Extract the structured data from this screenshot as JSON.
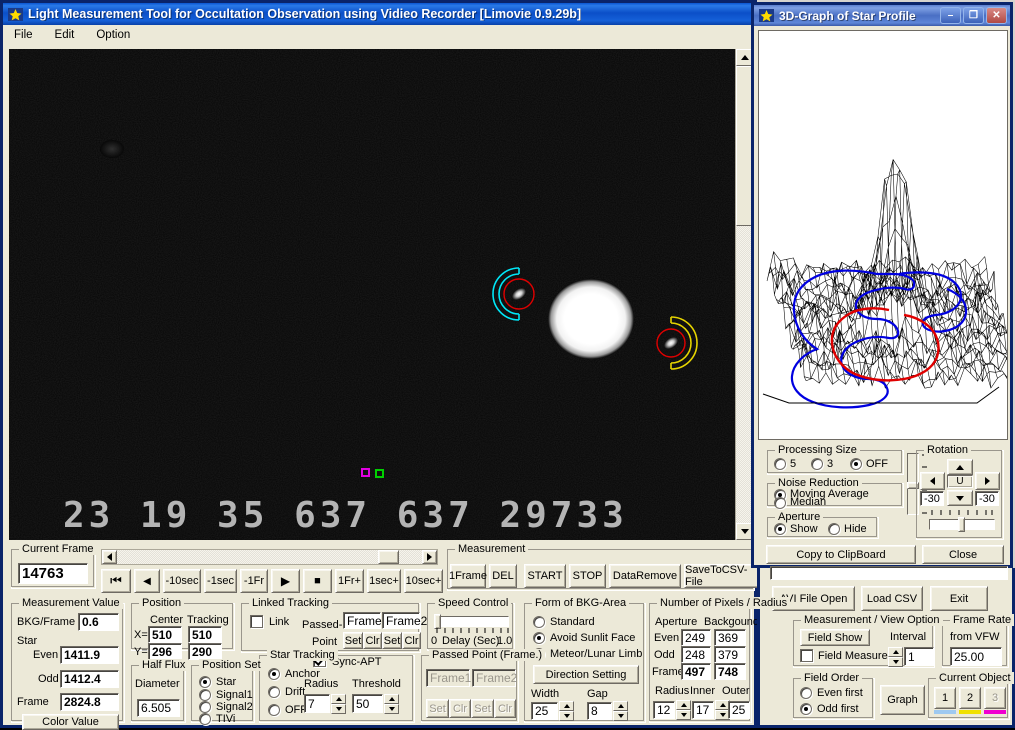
{
  "main_window": {
    "title": "Light Measurement Tool for Occultation Observation using Vidieo Recorder [Limovie 0.9.29b]",
    "menu": [
      "File",
      "Edit",
      "Option"
    ]
  },
  "video_overlay": {
    "vti_line": "23  19  35    637     637    29733"
  },
  "playback": {
    "current_frame_label": "Current Frame",
    "current_frame_value": "14763",
    "buttons": [
      "⏮",
      "◀",
      "-10sec",
      "-1sec",
      "-1Fr",
      "▶",
      "■",
      "1Fr+",
      "1sec+",
      "10sec+"
    ]
  },
  "measurement_toolbar": {
    "legend": "Measurement",
    "buttons": [
      "1Frame",
      "DEL",
      "START",
      "STOP",
      "DataRemove",
      "SaveToCSV-File"
    ]
  },
  "measurement_value": {
    "legend": "Measurement Value",
    "bkg_label": "BKG/Frame",
    "bkg_value": "0.6",
    "star_label": "Star",
    "even_label": "Even",
    "even_value": "1411.9",
    "odd_label": "Odd",
    "odd_value": "1412.4",
    "frame_label": "Frame",
    "frame_value": "2824.8",
    "color_value_button": "Color Value"
  },
  "position": {
    "legend": "Position",
    "center_header": "Center",
    "tracking_header": "Tracking",
    "x_label": "X=",
    "y_label": "Y=",
    "x_center": "510",
    "x_tracking": "510",
    "y_center": "296",
    "y_tracking": "290"
  },
  "half_flux": {
    "legend": "Half Flux",
    "sub_label": "Diameter",
    "value": "6.505"
  },
  "position_set": {
    "legend": "Position Set",
    "options": [
      "Star",
      "Signal1",
      "Signal2",
      "TIVi"
    ],
    "selected": "Star"
  },
  "linked_tracking": {
    "legend": "Linked Tracking",
    "link_label": "Link",
    "link_checked": false,
    "passed_label": "Passed-",
    "point_label": "Point",
    "frame1": "Frame1",
    "frame2": "Frame2",
    "set": "Set",
    "clr": "Clr"
  },
  "star_tracking": {
    "legend": "Star Tracking",
    "options": [
      "Anchor",
      "Drift",
      "OFF"
    ],
    "selected": "Anchor",
    "sync_apt_label": "Sync-APT",
    "sync_apt_checked": true,
    "radius_label": "Radius",
    "radius_value": "7",
    "threshold_label": "Threshold",
    "threshold_value": "50"
  },
  "speed_control": {
    "legend": "Speed Control",
    "min_label": "0",
    "name_label": "Delay (Sec)",
    "max_label": "1.0"
  },
  "passed_point": {
    "legend": "Passed Point (Frame.)",
    "frame1": "Frame1",
    "frame2": "Frame2",
    "set": "Set",
    "clr": "Clr"
  },
  "bkg_area": {
    "legend": "Form of BKG-Area",
    "options": [
      "Standard",
      "Avoid Sunlit Face",
      "Meteor/Lunar Limb"
    ],
    "selected": "Avoid Sunlit Face",
    "direction_button": "Direction Setting",
    "width_label": "Width",
    "width_value": "25",
    "gap_label": "Gap",
    "gap_value": "8"
  },
  "pixels_radius": {
    "legend": "Number of Pixels / Radius",
    "aperture_header": "Aperture",
    "background_header": "Backgound",
    "rows": [
      {
        "label": "Even",
        "aperture": "249",
        "background": "369"
      },
      {
        "label": "Odd",
        "aperture": "248",
        "background": "379"
      },
      {
        "label": "Frame",
        "aperture": "497",
        "background": "748"
      }
    ],
    "radius_label": "Radius",
    "radius_value": "12",
    "inner_label": "Inner",
    "inner_value": "17",
    "outer_label": "Outer",
    "outer_value": "25"
  },
  "graph_window": {
    "title": "3D-Graph of Star Profile",
    "minimize": "–",
    "maximize": "❐",
    "close": "✕",
    "processing_size": {
      "legend": "Processing Size",
      "options": [
        "5",
        "3",
        "OFF"
      ],
      "selected": "OFF"
    },
    "noise_reduction": {
      "legend": "Noise Reduction",
      "options": [
        "Moving Average",
        "Median"
      ],
      "selected": "Moving Average"
    },
    "aperture": {
      "legend": "Aperture",
      "options": [
        "Show",
        "Hide"
      ],
      "selected": "Show"
    },
    "rotation": {
      "legend": "Rotation",
      "center_button": "U",
      "left_value": "-30",
      "right_value": "-30"
    },
    "copy_button": "Copy to ClipBoard",
    "close_button": "Close"
  },
  "file_bar": {
    "avi_open": "AVI File Open",
    "load_csv": "Load CSV",
    "exit": "Exit"
  },
  "view_option": {
    "legend": "Measurement / View Option",
    "field_show_button": "Field Show",
    "field_measure_label": "Field Measure",
    "field_measure_checked": false,
    "interval_label": "Interval",
    "interval_value": "1"
  },
  "frame_rate": {
    "legend": "Frame Rate",
    "sub_legend": "from VFW",
    "value": "25.00"
  },
  "field_order": {
    "legend": "Field Order",
    "options": [
      "Even first",
      "Odd first"
    ],
    "selected": "Odd first"
  },
  "graph_button": "Graph",
  "current_object": {
    "legend": "Current Object",
    "buttons": [
      "1",
      "2",
      "3"
    ],
    "colors": [
      "#9ec9f0",
      "#f0e000",
      "#f000d0"
    ],
    "disabled_index": 2
  },
  "colors": {
    "title_bar": "#0a4fc8",
    "face": "#ece9d8",
    "aperture_star1": "#00e0f0",
    "aperture_star2": "#e0d000",
    "inner_circle": "#e00000",
    "graph_blue": "#0000e0",
    "graph_red": "#e00000"
  },
  "chart_data": {
    "type": "heatmap",
    "title": "3D-Graph of Star Profile",
    "description": "3D wireframe surface of pixel intensity around the target star; sharp central peak rising from a noisy background mesh, with blue background-annulus contour and red aperture contour overlaid.",
    "peak_position": [
      0.5,
      0.5
    ],
    "peak_height": 1.0,
    "background_level": 0.06,
    "grid": true,
    "contours": [
      {
        "name": "background annulus",
        "color": "#0000e0"
      },
      {
        "name": "aperture",
        "color": "#e00000"
      }
    ]
  }
}
